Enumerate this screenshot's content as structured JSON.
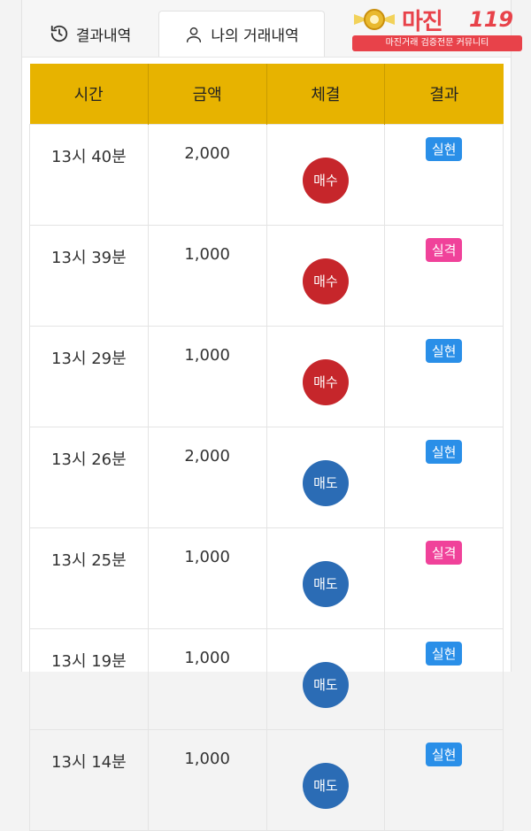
{
  "tabs": [
    {
      "label": "결과내역",
      "icon": "history-icon"
    },
    {
      "label": "나의 거래내역",
      "icon": "user-icon"
    }
  ],
  "logo": {
    "title": "마진",
    "number": "119",
    "subtitle": "마진거래 검증전문 커뮤니티"
  },
  "table": {
    "headers": [
      "시간",
      "금액",
      "체결",
      "결과"
    ],
    "rows": [
      {
        "time": "13시 40분",
        "amount": "2,000",
        "trade": "매수",
        "result": "실현"
      },
      {
        "time": "13시 39분",
        "amount": "1,000",
        "trade": "매수",
        "result": "실격"
      },
      {
        "time": "13시 29분",
        "amount": "1,000",
        "trade": "매수",
        "result": "실현"
      },
      {
        "time": "13시 26분",
        "amount": "2,000",
        "trade": "매도",
        "result": "실현"
      },
      {
        "time": "13시 25분",
        "amount": "1,000",
        "trade": "매도",
        "result": "실격"
      },
      {
        "time": "13시 19분",
        "amount": "1,000",
        "trade": "매도",
        "result": "실현"
      },
      {
        "time": "13시 14분",
        "amount": "1,000",
        "trade": "매도",
        "result": "실현"
      }
    ]
  },
  "colors": {
    "header_bg": "#e7b300",
    "buy": "#c6262b",
    "sell": "#2b6cb5",
    "win": "#2a8fe8",
    "lose": "#f0429a"
  }
}
